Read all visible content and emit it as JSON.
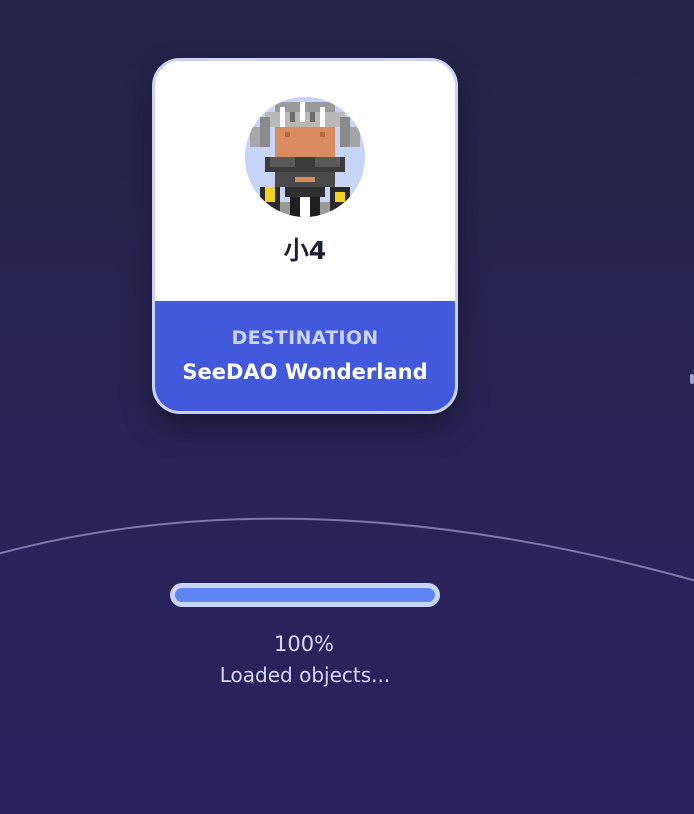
{
  "player": {
    "name": "小4",
    "avatar_icon": "pixel-avatar-icon"
  },
  "destination": {
    "label": "DESTINATION",
    "value": "SeeDAO Wonderland"
  },
  "loading": {
    "progress": 1.0,
    "percent_text": "100%",
    "status_text": "Loaded objects..."
  },
  "colors": {
    "background_top": "#222546",
    "background_bottom": "#2d2161",
    "card_bottom": "#4359db",
    "progress_fill": "#5f85f2",
    "progress_track": "#c9d3f6"
  }
}
